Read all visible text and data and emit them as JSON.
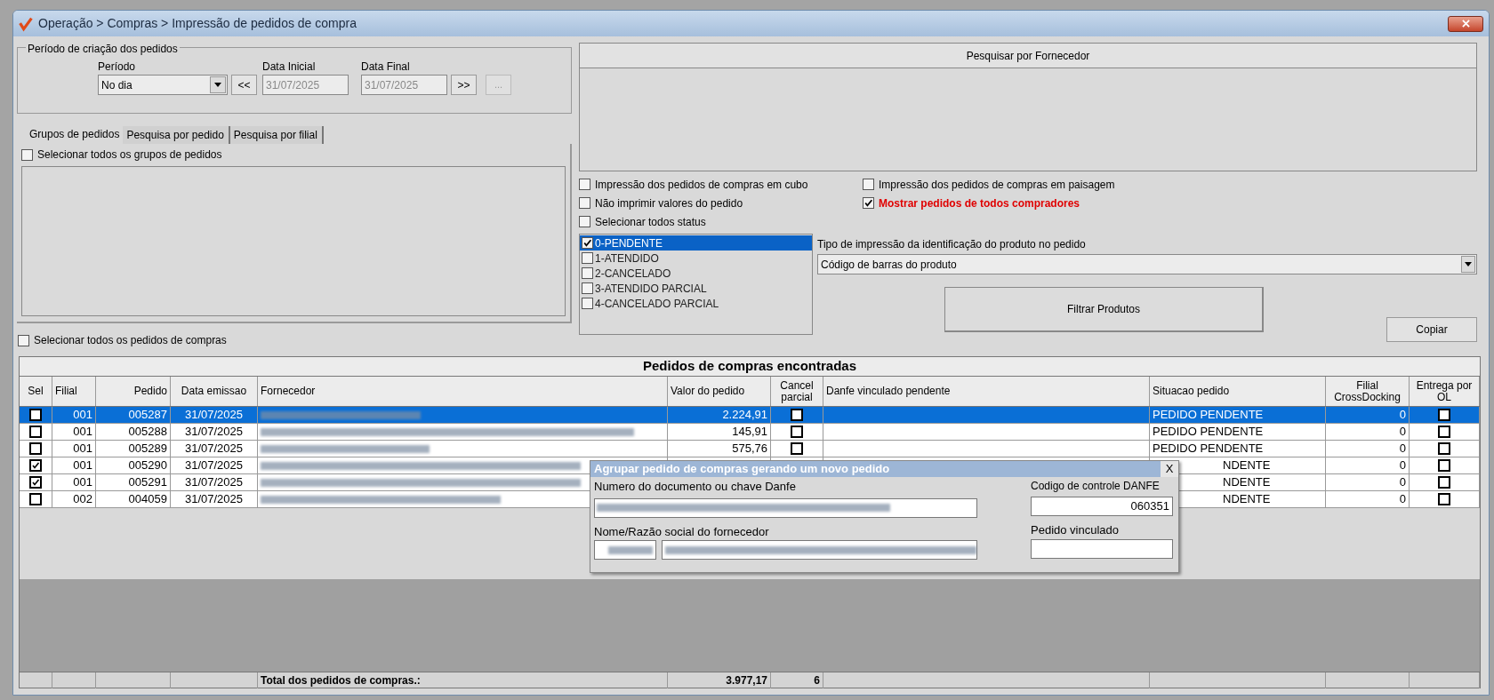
{
  "window": {
    "title": "Operação > Compras > Impressão de pedidos de compra"
  },
  "period_group": {
    "legend": "Período de criação dos pedidos",
    "period_label": "Período",
    "period_value": "No dia",
    "prev_button": "<<",
    "start_label": "Data Inicial",
    "start_value": "31/07/2025",
    "end_label": "Data Final",
    "end_value": "31/07/2025",
    "next_button": ">>",
    "more_button": "..."
  },
  "tabs": [
    {
      "label": "Grupos de pedidos",
      "selected": true
    },
    {
      "label": "Pesquisa por pedido",
      "selected": false
    },
    {
      "label": "Pesquisa por filial",
      "selected": false
    }
  ],
  "select_all_groups": {
    "label": "Selecionar todos os grupos de pedidos",
    "checked": false
  },
  "select_all_orders": {
    "label": "Selecionar todos os pedidos de compras",
    "checked": false
  },
  "supplier_search_button": "Pesquisar por Fornecedor",
  "options": [
    {
      "label": "Impressão dos pedidos de compras em cubo",
      "checked": false,
      "highlight": false
    },
    {
      "label": "Impressão dos pedidos de compras em paisagem",
      "checked": false,
      "highlight": false
    },
    {
      "label": "Não imprimir valores do pedido",
      "checked": false,
      "highlight": false
    },
    {
      "label": "Mostrar pedidos de todos compradores",
      "checked": true,
      "highlight": true
    },
    {
      "label": "Selecionar todos status",
      "checked": false,
      "highlight": false
    }
  ],
  "status_list": [
    {
      "label": "0-PENDENTE",
      "checked": true,
      "selected": true
    },
    {
      "label": "1-ATENDIDO",
      "checked": false,
      "selected": false
    },
    {
      "label": "2-CANCELADO",
      "checked": false,
      "selected": false
    },
    {
      "label": "3-ATENDIDO PARCIAL",
      "checked": false,
      "selected": false
    },
    {
      "label": "4-CANCELADO PARCIAL",
      "checked": false,
      "selected": false
    }
  ],
  "print_type": {
    "label": "Tipo de impressão da identificação do produto no pedido",
    "value": "Código de barras do produto"
  },
  "filter_button": "Filtrar Produtos",
  "copy_button": "Copiar",
  "table": {
    "title": "Pedidos de compras encontradas",
    "columns": [
      "Sel",
      "Filial",
      "Pedido",
      "Data emissao",
      "Fornecedor",
      "Valor do pedido",
      "Cancel parcial",
      "Danfe vinculado pendente",
      "Situacao pedido",
      "Filial CrossDocking",
      "Entrega por OL"
    ],
    "rows": [
      {
        "selected": true,
        "sel": false,
        "filial": "001",
        "pedido": "005287",
        "data": "31/07/2025",
        "valor": "2.224,91",
        "cancel": false,
        "situacao": "PEDIDO PENDENTE",
        "crossdocking": "0",
        "entrega": false
      },
      {
        "selected": false,
        "sel": false,
        "filial": "001",
        "pedido": "005288",
        "data": "31/07/2025",
        "valor": "145,91",
        "cancel": false,
        "situacao": "PEDIDO PENDENTE",
        "crossdocking": "0",
        "entrega": false
      },
      {
        "selected": false,
        "sel": false,
        "filial": "001",
        "pedido": "005289",
        "data": "31/07/2025",
        "valor": "575,76",
        "cancel": false,
        "situacao": "PEDIDO PENDENTE",
        "crossdocking": "0",
        "entrega": false
      },
      {
        "selected": false,
        "sel": true,
        "filial": "001",
        "pedido": "005290",
        "data": "31/07/2025",
        "situacao": "NDENTE",
        "crossdocking": "0",
        "entrega": false
      },
      {
        "selected": false,
        "sel": true,
        "filial": "001",
        "pedido": "005291",
        "data": "31/07/2025",
        "situacao": "NDENTE",
        "crossdocking": "0",
        "entrega": false
      },
      {
        "selected": false,
        "sel": false,
        "filial": "002",
        "pedido": "004059",
        "data": "31/07/2025",
        "situacao": "NDENTE",
        "crossdocking": "0",
        "entrega": false
      }
    ],
    "footer": {
      "label": "Total dos pedidos de compras.:",
      "total": "3.977,17",
      "count": "6"
    }
  },
  "dialog": {
    "title": "Agrupar pedido de compras gerando um novo pedido",
    "close": "X",
    "document_label": "Numero do documento ou chave Danfe",
    "control_label": "Codigo de controle DANFE",
    "control_value": "060351",
    "supplier_label": "Nome/Razão social do fornecedor",
    "linked_label": "Pedido vinculado"
  }
}
